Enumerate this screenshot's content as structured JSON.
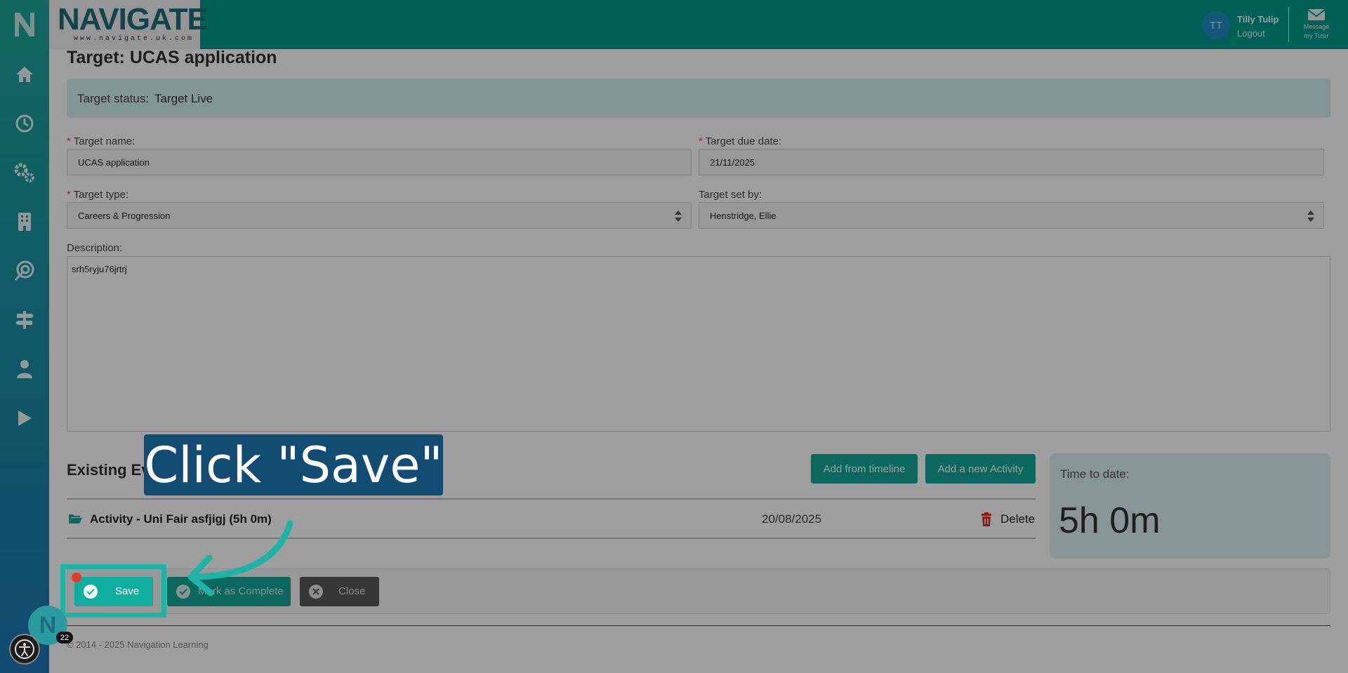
{
  "header": {
    "brand": "NAVIGATE",
    "brand_url": "www.navigate.uk.com",
    "user_initials": "TT",
    "user_name": "Tilly Tulip",
    "logout": "Logout",
    "message_tutor_line1": "Message",
    "message_tutor_line2": "my Tutor"
  },
  "sidebar": {
    "logo": "N",
    "items": [
      {
        "icon": "home-icon"
      },
      {
        "icon": "clock-icon"
      },
      {
        "icon": "gears-icon"
      },
      {
        "icon": "building-icon"
      },
      {
        "icon": "target-icon"
      },
      {
        "icon": "signpost-icon"
      },
      {
        "icon": "person-icon"
      },
      {
        "icon": "play-icon"
      }
    ]
  },
  "main": {
    "title": "Target: UCAS application",
    "status_label": "Target status:",
    "status_value": "Target Live",
    "fields": {
      "target_name_label": "Target name:",
      "target_name_value": "UCAS application",
      "due_date_label": "Target due date:",
      "due_date_value": "21/11/2025",
      "target_type_label": "Target type:",
      "target_type_value": "Careers & Progression",
      "set_by_label": "Target set by:",
      "set_by_value": "Henstridge, Ellie",
      "description_label": "Description:",
      "description_value": "srh5ryju76jrtrj"
    },
    "evidence": {
      "title": "Existing Ev",
      "add_from_timeline": "Add from timeline",
      "add_activity": "Add a new Activity",
      "activities": [
        {
          "name": "Activity - Uni Fair asfjigj (5h 0m)",
          "date": "20/08/2025",
          "delete": "Delete"
        }
      ]
    },
    "time": {
      "label": "Time to date:",
      "value": "5h 0m"
    },
    "actions": {
      "save": "Save",
      "complete": "Mark as Complete",
      "close": "Close"
    },
    "footer": "© 2014 - 2025 Navigation Learning"
  },
  "overlay": {
    "callout": "Click \"Save\"",
    "badge_letter": "N",
    "badge_count": "22"
  },
  "colors": {
    "primary": "#14a99a",
    "header": "#009a8c",
    "callout": "#124c72",
    "highlight": "#1fb3a5",
    "danger": "#c0392b"
  }
}
